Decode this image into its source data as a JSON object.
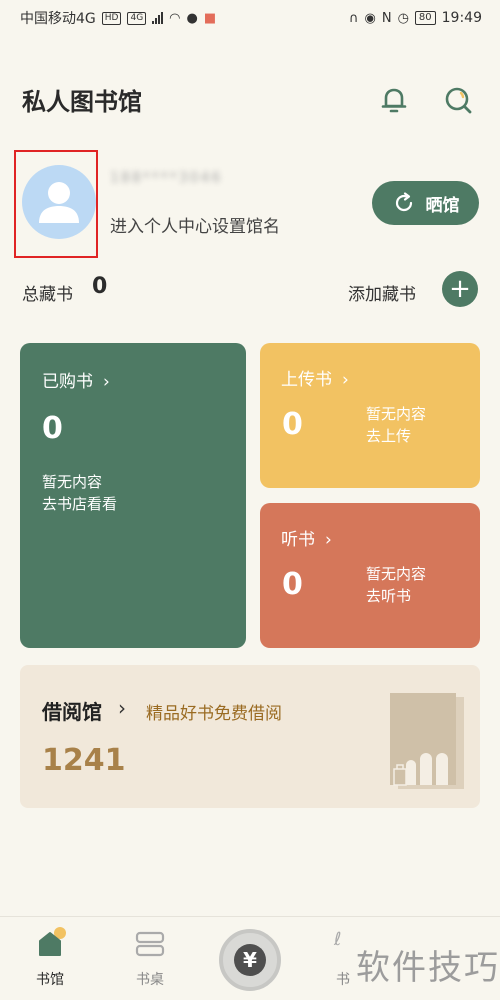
{
  "status_bar": {
    "carrier": "中国移动4G",
    "chip_hd": "HD",
    "chip_4g": "4G",
    "battery": "80",
    "time": "19:49"
  },
  "header": {
    "title": "私人图书馆",
    "bell_icon": "bell-icon",
    "search_icon": "search-icon"
  },
  "profile": {
    "user_id_masked": "188****3046",
    "hint": "进入个人中心设置馆名",
    "show_button": "晒馆"
  },
  "collection": {
    "total_label": "总藏书",
    "total_count": "0",
    "add_label": "添加藏书"
  },
  "cards": {
    "purchased": {
      "title": "已购书",
      "count": "0",
      "empty_line1": "暂无内容",
      "empty_line2": "去书店看看"
    },
    "upload": {
      "title": "上传书",
      "count": "0",
      "empty_line1": "暂无内容",
      "empty_line2": "去上传"
    },
    "listen": {
      "title": "听书",
      "count": "0",
      "empty_line1": "暂无内容",
      "empty_line2": "去听书"
    }
  },
  "lending": {
    "title": "借阅馆",
    "subtitle": "精品好书免费借阅",
    "count": "1241"
  },
  "bottom_nav": {
    "home": "书馆",
    "desk": "书桌",
    "right_partial": "书",
    "center_symbol": "¥"
  },
  "watermark": "软件技巧",
  "colors": {
    "primary_green": "#4e7a64",
    "upload_yellow": "#f2c262",
    "listen_orange": "#d5775a",
    "lending_bg": "#f1e8da",
    "highlight_red": "#e02424"
  }
}
